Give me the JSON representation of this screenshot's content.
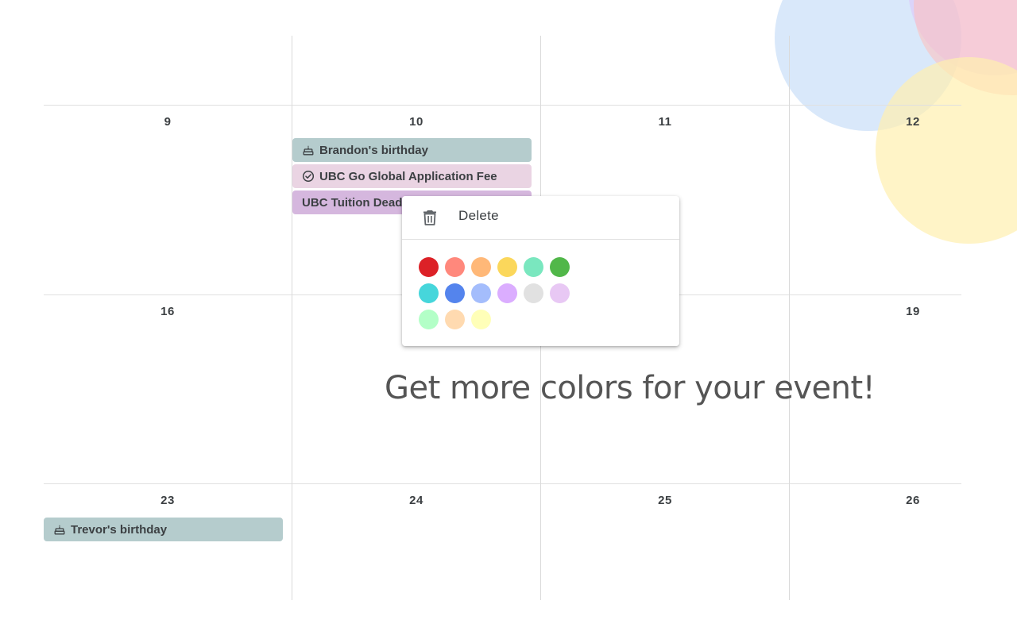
{
  "calendar": {
    "weeks": [
      {
        "days": [
          "9",
          "10",
          "11",
          "12"
        ]
      },
      {
        "days": [
          "16",
          "",
          "",
          "19"
        ]
      },
      {
        "days": [
          "23",
          "24",
          "25",
          "26"
        ]
      }
    ],
    "events": [
      {
        "title": "Brandon's birthday",
        "icon": "cake-icon",
        "color": "#b5cccd"
      },
      {
        "title": "UBC Go Global Application Fee",
        "icon": "task-check-icon",
        "color": "#ead4e3"
      },
      {
        "title": "UBC Tuition Dead",
        "icon": "",
        "color": "#d5b7de"
      },
      {
        "title": "Trevor's birthday",
        "icon": "cake-icon",
        "color": "#b5cccd"
      }
    ]
  },
  "context_menu": {
    "delete_label": "Delete",
    "delete_icon": "trash-icon",
    "colors": [
      "#dc2127",
      "#ff887c",
      "#ffb878",
      "#fbd75b",
      "#7ae7bf",
      "#51b749",
      "#46d6db",
      "#5484ed",
      "#a4bdfc",
      "#dbadff",
      "#e1e1e1",
      "#e8c8f4",
      "#b3ffc7",
      "#ffdab0",
      "#ffffb8"
    ]
  },
  "promo_text": "Get more colors for your event!",
  "decor": {
    "circle_colors": [
      "#d6e6f8",
      "#e6d6fc",
      "#ffd2cd",
      "#fdf1c4"
    ]
  }
}
